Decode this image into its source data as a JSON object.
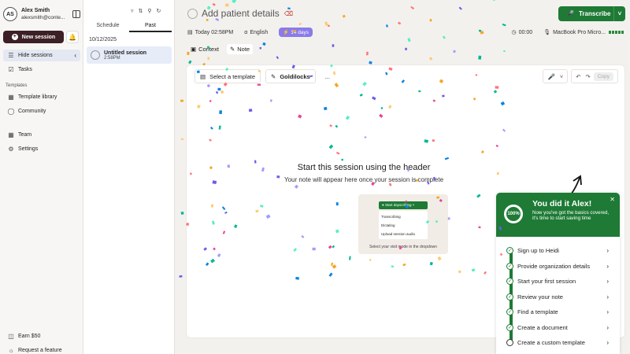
{
  "user": {
    "initials": "AS",
    "name": "Alex Smith",
    "email": "alexsmith@conte..."
  },
  "sidebar": {
    "new_session": "New session",
    "hide_sessions": "Hide sessions",
    "tasks": "Tasks",
    "templates_label": "Templates",
    "template_library": "Template library",
    "community": "Community",
    "team": "Team",
    "settings": "Settings",
    "earn": "Earn $50",
    "request": "Request a feature"
  },
  "sessions": {
    "tab_schedule": "Schedule",
    "tab_past": "Past",
    "date": "10/12/2025",
    "item_title": "Untitled session",
    "item_time": "2:58PM"
  },
  "header": {
    "title": "Add patient details",
    "transcribe": "Transcribe",
    "date": "Today 02:58PM",
    "language": "English",
    "days": "14 days",
    "timer": "00:00",
    "mic": "MacBook Pro Micro..."
  },
  "tabs": {
    "context": "Context",
    "note": "Note"
  },
  "toolbar": {
    "select_template": "Select a template",
    "goldilocks": "Goldilocks",
    "more": "...",
    "copy": "Copy"
  },
  "empty": {
    "title": "Start this session using the header",
    "subtitle": "Your note will appear here once your session is complete",
    "preview_button": "Start dayscribing",
    "preview_options": [
      "Transcribing",
      "Dictating",
      "Upload session audio"
    ],
    "preview_caption": "Select your visit mode in the dropdown"
  },
  "onboarding": {
    "percent": "100%",
    "title": "You did it Alex!",
    "desc": "Now you've got the basics covered, it's time to start saving time",
    "items": [
      "Sign up to Heidi",
      "Provide organization details",
      "Start your first session",
      "Review your note",
      "Find a template",
      "Create a document",
      "Create a custom template"
    ]
  },
  "colors": {
    "brand_green": "#1e7a35",
    "new_session_bg": "#3d1f26",
    "days_badge": "#8a7be8"
  }
}
